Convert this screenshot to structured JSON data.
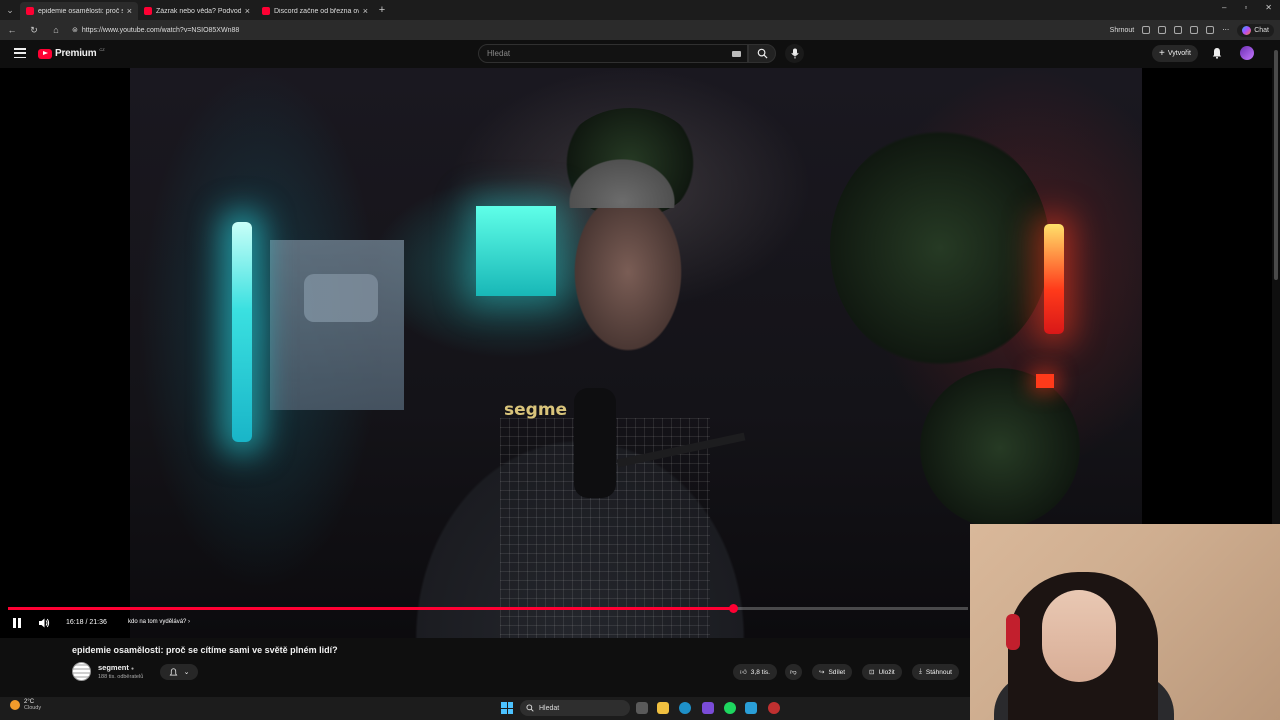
{
  "browser": {
    "tabs": [
      {
        "title": "epidemie osamělosti: proč se",
        "active": true
      },
      {
        "title": "Zázrak nebo věda? Podvod? - You",
        "active": false
      },
      {
        "title": "Discord začne od března ověřova",
        "active": false
      }
    ],
    "url": "https://www.youtube.com/watch?v=NSIO85XWn88",
    "summarize_label": "Shrnout",
    "copilot_label": "Chat"
  },
  "youtube": {
    "logo_text": "Premium",
    "logo_region": "CZ",
    "search_placeholder": "Hledat",
    "create_label": "Vytvořit"
  },
  "player": {
    "time": "16:18 / 21:36",
    "chapter": "kdo na tom vydělává?",
    "progress_fraction": 0.755,
    "buffered_fraction": 1.0,
    "shirt_text": "segme"
  },
  "video": {
    "title": "epidemie osamělosti: proč se cítíme sami ve světě plném lidí?",
    "channel": "segment",
    "subscribers": "188 tis. odběratelů",
    "likes": "3,8 tis.",
    "share_label": "Sdílet",
    "save_label": "Uložit",
    "download_label": "Stáhnout"
  },
  "taskbar": {
    "temperature": "2°C",
    "weather": "Cloudy",
    "search_label": "Hledat"
  },
  "colors": {
    "accent": "#ff0033",
    "background": "#0f0f0f"
  }
}
